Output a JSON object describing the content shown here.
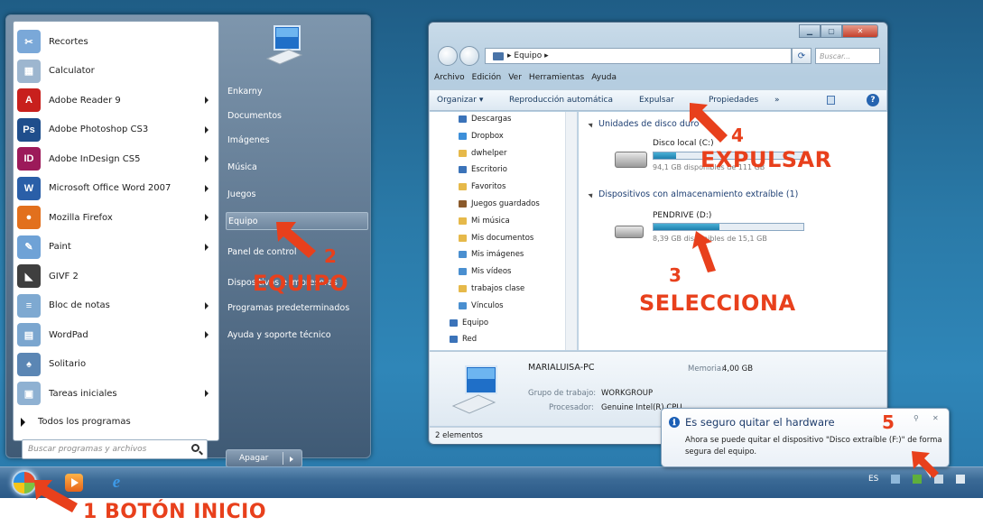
{
  "start_menu": {
    "programs": [
      {
        "label": "Recortes",
        "icon": "snipping-tool-icon",
        "color": "#7aa8d8",
        "glyph": "✂",
        "arrow": false
      },
      {
        "label": "Calculator",
        "icon": "calculator-icon",
        "color": "#9db6cf",
        "glyph": "▦",
        "arrow": false
      },
      {
        "label": "Adobe Reader 9",
        "icon": "adobe-reader-icon",
        "color": "#c8201d",
        "glyph": "A",
        "arrow": true
      },
      {
        "label": "Adobe Photoshop CS3",
        "icon": "photoshop-icon",
        "color": "#1f4e8c",
        "glyph": "Ps",
        "arrow": true
      },
      {
        "label": "Adobe InDesign CS5",
        "icon": "indesign-icon",
        "color": "#9c1a5a",
        "glyph": "ID",
        "arrow": true
      },
      {
        "label": "Microsoft Office Word 2007",
        "icon": "word-icon",
        "color": "#2a5fa8",
        "glyph": "W",
        "arrow": true
      },
      {
        "label": "Mozilla Firefox",
        "icon": "firefox-icon",
        "color": "#e2701d",
        "glyph": "●",
        "arrow": true
      },
      {
        "label": "Paint",
        "icon": "paint-icon",
        "color": "#6fa2d6",
        "glyph": "✎",
        "arrow": true
      },
      {
        "label": "GIVF 2",
        "icon": "givf-icon",
        "color": "#3f3f3f",
        "glyph": "◣",
        "arrow": false
      },
      {
        "label": "Bloc de notas",
        "icon": "notepad-icon",
        "color": "#7ea9d1",
        "glyph": "≡",
        "arrow": true
      },
      {
        "label": "WordPad",
        "icon": "wordpad-icon",
        "color": "#7ba6cf",
        "glyph": "▤",
        "arrow": true
      },
      {
        "label": "Solitario",
        "icon": "solitaire-icon",
        "color": "#5b86b4",
        "glyph": "♠",
        "arrow": false
      },
      {
        "label": "Tareas iniciales",
        "icon": "getting-started-icon",
        "color": "#8fb1d2",
        "glyph": "▣",
        "arrow": true
      }
    ],
    "all_programs": "Todos los programas",
    "search_placeholder": "Buscar programas y archivos",
    "right_items": [
      {
        "label": "Enkarny",
        "highlight": false
      },
      {
        "label": "Documentos",
        "highlight": false
      },
      {
        "label": "Imágenes",
        "highlight": false
      },
      {
        "label": "Música",
        "highlight": false
      },
      {
        "label": "Juegos",
        "highlight": false
      },
      {
        "label": "Equipo",
        "highlight": true
      },
      {
        "label": "Panel de control",
        "highlight": false
      },
      {
        "label": "Dispositivos e impresoras",
        "highlight": false
      },
      {
        "label": "Programas predeterminados",
        "highlight": false
      },
      {
        "label": "Ayuda y soporte técnico",
        "highlight": false
      }
    ],
    "shutdown_label": "Apagar"
  },
  "explorer": {
    "address": "▸ Equipo ▸",
    "search_placeholder": "Buscar...",
    "menu": [
      "Archivo",
      "Edición",
      "Ver",
      "Herramientas",
      "Ayuda"
    ],
    "commands": [
      "Organizar ▾",
      "Reproducción automática",
      "Expulsar",
      "Propiedades",
      "»"
    ],
    "nav_items": [
      {
        "label": "Descargas",
        "color": "#3b73b9"
      },
      {
        "label": "Dropbox",
        "color": "#3d8fd9"
      },
      {
        "label": "dwhelper",
        "color": "#e6b94a"
      },
      {
        "label": "Escritorio",
        "color": "#3b73b9"
      },
      {
        "label": "Favoritos",
        "color": "#e6b94a"
      },
      {
        "label": "Juegos guardados",
        "color": "#8b5a2b"
      },
      {
        "label": "Mi música",
        "color": "#e6b94a"
      },
      {
        "label": "Mis documentos",
        "color": "#e6b94a"
      },
      {
        "label": "Mis imágenes",
        "color": "#4a8fd0"
      },
      {
        "label": "Mis vídeos",
        "color": "#4a8fd0"
      },
      {
        "label": "trabajos clase",
        "color": "#e6b94a"
      },
      {
        "label": "Vínculos",
        "color": "#4a8fd0"
      },
      {
        "label": "Equipo",
        "color": "#3b73b9"
      },
      {
        "label": "Red",
        "color": "#3b73b9"
      }
    ],
    "group_hdd": "Unidades de disco duro",
    "hdd": {
      "name": "Disco local (C:)",
      "free": "94,1 GB disponibles de 111 GB",
      "used_fraction": 0.15
    },
    "group_removable": "Dispositivos con almacenamiento extraíble (1)",
    "usb": {
      "name": "PENDRIVE (D:)",
      "free": "8,39 GB disponibles de 15,1 GB",
      "used_fraction": 0.44
    },
    "details": {
      "pc_name": "MARIALUISA-PC",
      "memory_label": "Memoria:",
      "memory_value": "4,00 GB",
      "workgroup_label": "Grupo de trabajo:",
      "workgroup_value": "WORKGROUP",
      "processor_label": "Procesador:",
      "processor_value": "Genuine Intel(R) CPU"
    },
    "status": "2 elementos"
  },
  "balloon": {
    "title": "Es seguro quitar el hardware",
    "body": "Ahora se puede quitar el dispositivo \"Disco extraíble (F:)\" de forma segura del equipo.",
    "pin": "ℹ",
    "close": "✕"
  },
  "taskbar": {
    "tray_lang": "ES"
  },
  "annotations": {
    "a1": "1 BOTÓN INICIO",
    "a2_num": "2",
    "a2": "EQUIPO",
    "a3_num": "3",
    "a3": "SELECCIONA",
    "a4_num": "4",
    "a4": "EXPULSAR",
    "a5": "5"
  },
  "colors": {
    "annotation": "#e8401c",
    "desktop": "#2a7aa8",
    "start_menu_bg": "#5f7891"
  }
}
